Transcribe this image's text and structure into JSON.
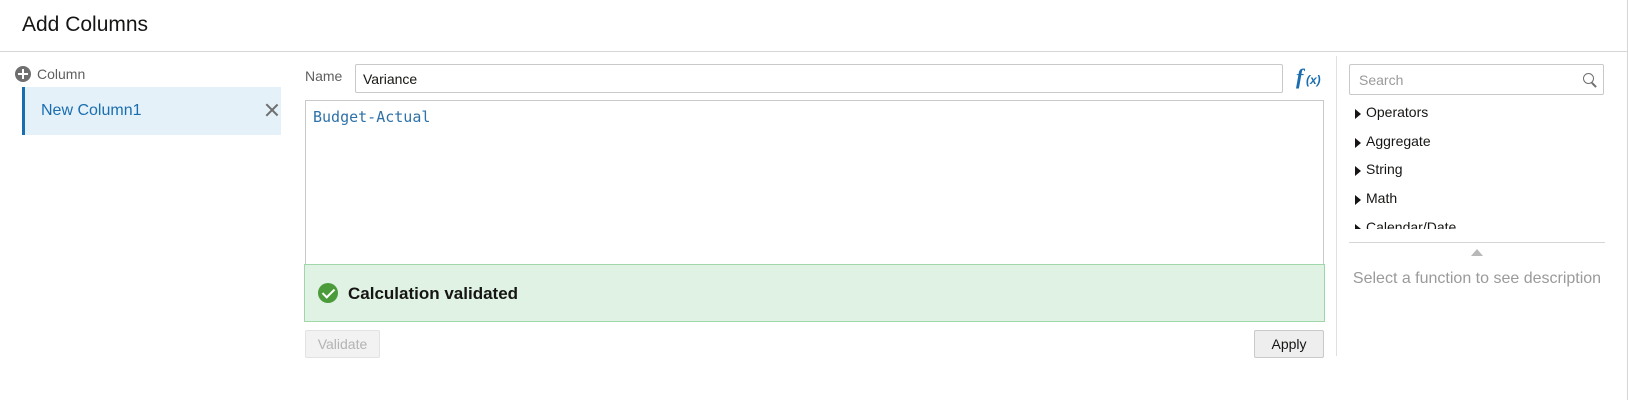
{
  "dialog": {
    "title": "Add Columns"
  },
  "columns": {
    "add_label": "Column",
    "items": [
      {
        "label": "New Column1",
        "selected": true
      }
    ]
  },
  "editor": {
    "name_label": "Name",
    "name_value": "Variance",
    "expression": "Budget-Actual",
    "validation_message": "Calculation validated",
    "validate_label": "Validate",
    "apply_label": "Apply"
  },
  "functions": {
    "search_placeholder": "Search",
    "categories": [
      "Operators",
      "Aggregate",
      "String",
      "Math"
    ],
    "partial_category": "Calendar/Date",
    "description_placeholder": "Select a function to see description"
  },
  "icons": {
    "add": "plus-circle-icon",
    "remove": "close-icon",
    "function_picker": "fx-icon",
    "status": "check-circle-icon",
    "search": "search-icon",
    "expand": "triangle-right-icon",
    "collapse": "triangle-up-icon"
  },
  "colors": {
    "accent": "#1a6eb0",
    "selected_bg": "#e4f1f9",
    "success_bg": "#dff2e3",
    "success_border": "#9fd7a8",
    "success_icon": "#4b9b3a",
    "expression_text": "#2f72a8"
  }
}
